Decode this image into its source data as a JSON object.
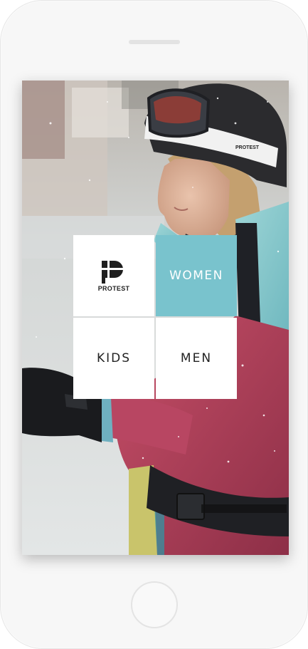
{
  "brand": {
    "logo_text": "PROTEST",
    "accent_color": "#79c3cd"
  },
  "categories": [
    {
      "label": "WOMEN"
    },
    {
      "label": "KIDS"
    },
    {
      "label": "MEN"
    }
  ],
  "photo": {
    "goggle_strap_logo": "PROTEST"
  },
  "icons": {
    "logo": "protest-logo-icon"
  }
}
